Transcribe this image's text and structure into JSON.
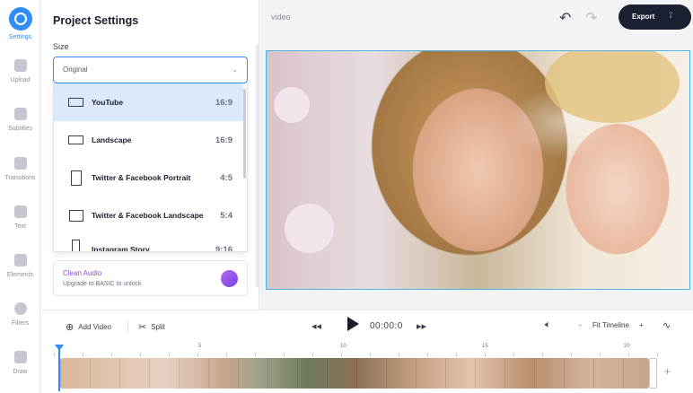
{
  "sidebar": {
    "items": [
      {
        "label": "Settings",
        "icon": "gear-icon",
        "active": true
      },
      {
        "label": "Upload",
        "icon": "plus-icon"
      },
      {
        "label": "Subtitles",
        "icon": "subtitles-icon"
      },
      {
        "label": "Transitions",
        "icon": "transitions-icon"
      },
      {
        "label": "Text",
        "icon": "text-icon"
      },
      {
        "label": "Elements",
        "icon": "elements-icon"
      },
      {
        "label": "Filters",
        "icon": "filters-icon"
      },
      {
        "label": "Draw",
        "icon": "pen-icon"
      }
    ]
  },
  "panel": {
    "title": "Project Settings",
    "size_label": "Size",
    "size_value": "Original",
    "size_options": [
      {
        "name": "YouTube",
        "ratio": "16:9",
        "selected": true
      },
      {
        "name": "Landscape",
        "ratio": "16:9"
      },
      {
        "name": "Twitter & Facebook Portrait",
        "ratio": "4:5"
      },
      {
        "name": "Twitter & Facebook Landscape",
        "ratio": "5:4"
      },
      {
        "name": "Instagram Story",
        "ratio": "9:16"
      }
    ],
    "clean_audio": {
      "title": "Clean Audio",
      "subtitle": "Upgrade to BASIC to unlock"
    }
  },
  "topbar": {
    "project_name": "video",
    "export_label": "Export"
  },
  "controls": {
    "add_video": "Add Video",
    "split": "Split",
    "time": "00:00:0",
    "zoom_minus": "-",
    "fit_timeline": "Fit Timeline",
    "zoom_plus": "+"
  },
  "timeline": {
    "ticks": [
      "5",
      "10",
      "15",
      "20"
    ],
    "add_clip": "+"
  },
  "colors": {
    "accent": "#2f8df5",
    "export_bg": "#1b2030",
    "audio_purple": "#8a4bd9",
    "selected_row": "#dce9fb"
  }
}
